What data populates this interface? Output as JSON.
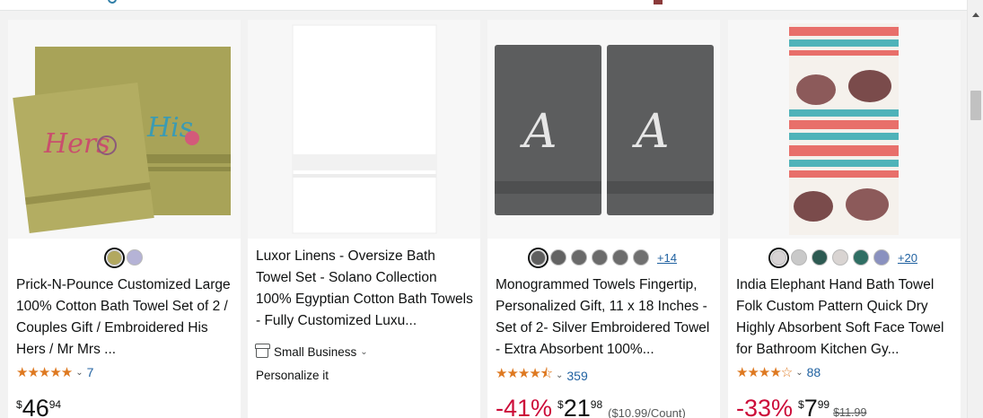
{
  "products": [
    {
      "title": "Prick-N-Pounce Customized Large 100% Cotton Bath Towel Set of 2 / Couples Gift / Embroidered His Hers / Mr Mrs ...",
      "image_label_1": "Hers",
      "image_label_2": "His",
      "swatches": [
        "#b2a85f",
        "#b5b3d6"
      ],
      "rating_stars": "★★★★★",
      "review_count": "7",
      "price": {
        "symbol": "$",
        "whole": "46",
        "fraction": "94"
      }
    },
    {
      "title": "Luxor Linens - Oversize Bath Towel Set - Solano Collection 100% Egyptian Cotton Bath Towels - Fully Customized Luxu...",
      "badge": "Small Business",
      "note": "Personalize it"
    },
    {
      "title": "Monogrammed Towels Fingertip, Personalized Gift, 11 x 18 Inches - Set of 2- Silver Embroidered Towel - Extra Absorbent 100%...",
      "image_letter": "A",
      "swatches": [
        "#5f5f5f",
        "#636363",
        "#6a6a6a",
        "#6b6b6b",
        "#6c6c6c",
        "#707070"
      ],
      "more_colors": "+14",
      "rating_stars": "★★★★⯪",
      "review_count": "359",
      "discount": "-41%",
      "price": {
        "symbol": "$",
        "whole": "21",
        "fraction": "98"
      },
      "unit_price": "($10.99/Count)"
    },
    {
      "title": "India Elephant Hand Bath Towel Folk Custom Pattern Quick Dry Highly Absorbent Soft Face Towel for Bathroom Kitchen Gy...",
      "swatches": [
        "#d7d3d4",
        "#c9c9c9",
        "#2d5a52",
        "#d9d4d2",
        "#2f6e63",
        "#8a91bf"
      ],
      "more_colors": "+20",
      "rating_stars": "★★★★☆",
      "review_count": "88",
      "discount": "-33%",
      "price": {
        "symbol": "$",
        "whole": "7",
        "fraction": "99"
      },
      "list_price": "$11.99"
    }
  ]
}
